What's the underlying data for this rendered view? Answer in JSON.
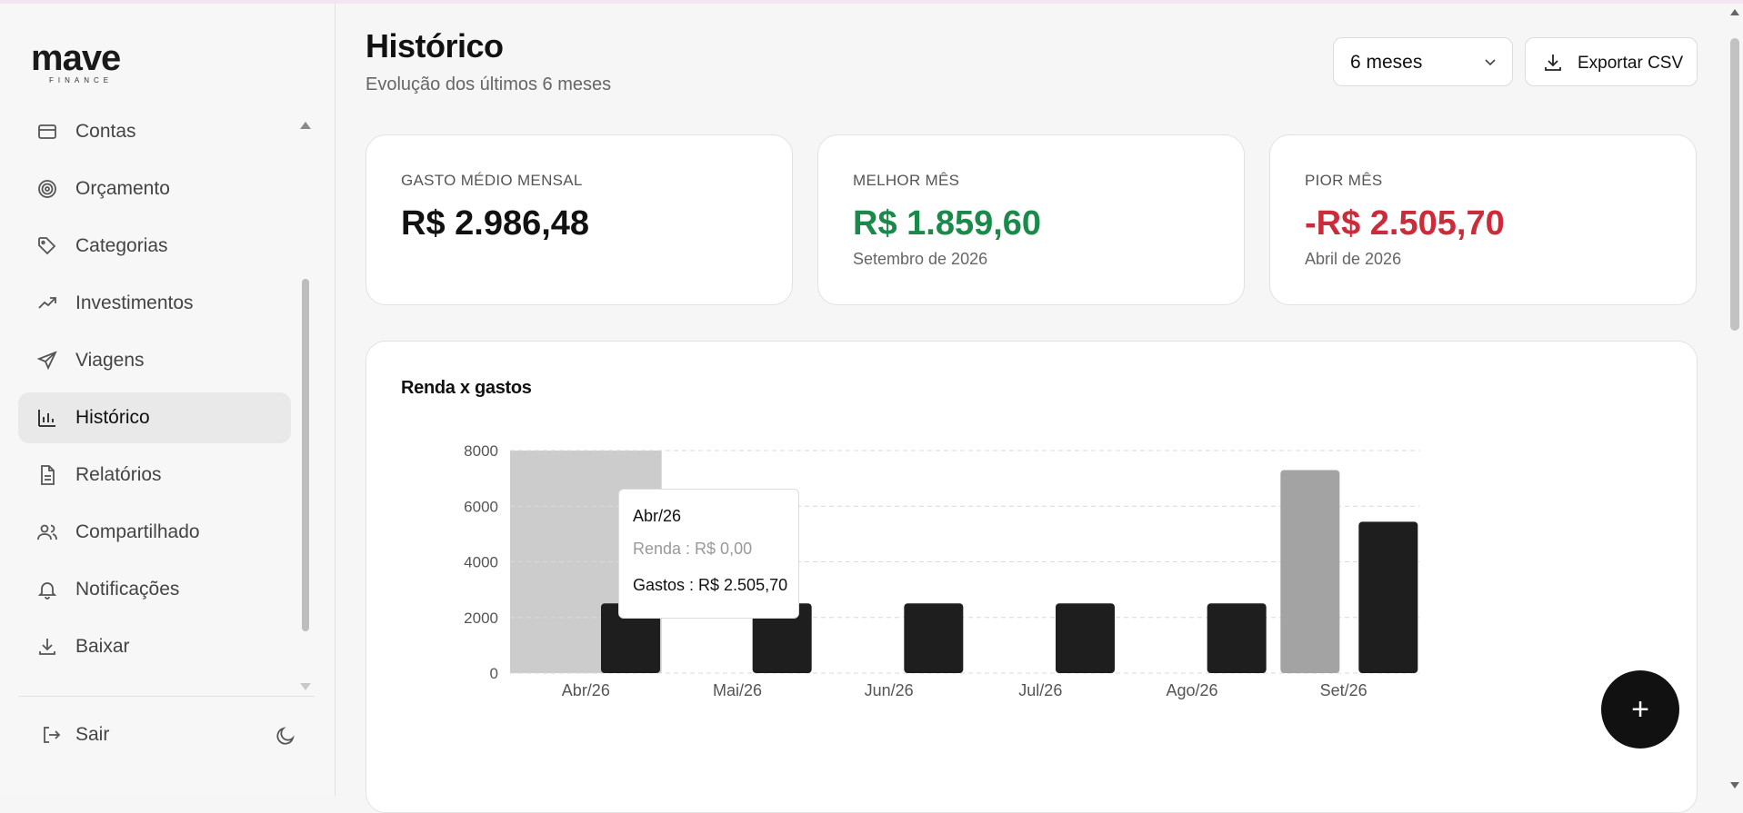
{
  "app": {
    "logo_text": "mave",
    "logo_sub": "FINANCE"
  },
  "sidebar": {
    "items": [
      {
        "label": "Contas",
        "icon": "credit-card-icon"
      },
      {
        "label": "Orçamento",
        "icon": "target-icon"
      },
      {
        "label": "Categorias",
        "icon": "tag-icon"
      },
      {
        "label": "Investimentos",
        "icon": "trending-up-icon"
      },
      {
        "label": "Viagens",
        "icon": "plane-icon"
      },
      {
        "label": "Histórico",
        "icon": "bar-chart-icon",
        "active": true
      },
      {
        "label": "Relatórios",
        "icon": "file-text-icon"
      },
      {
        "label": "Compartilhado",
        "icon": "users-icon"
      },
      {
        "label": "Notificações",
        "icon": "bell-icon"
      },
      {
        "label": "Baixar",
        "icon": "download-icon"
      }
    ],
    "logout_label": "Sair",
    "theme_icon": "moon-icon"
  },
  "header": {
    "title": "Histórico",
    "subtitle": "Evolução dos últimos 6 meses",
    "period_value": "6 meses",
    "export_label": "Exportar CSV"
  },
  "stats": [
    {
      "label": "GASTO MÉDIO MENSAL",
      "value": "R$ 2.986,48",
      "sub": "",
      "tone": "neutral"
    },
    {
      "label": "MELHOR MÊS",
      "value": "R$ 1.859,60",
      "sub": "Setembro de 2026",
      "tone": "positive",
      "color": "#1a8a4a"
    },
    {
      "label": "PIOR MÊS",
      "value": "-R$ 2.505,70",
      "sub": "Abril de 2026",
      "tone": "negative",
      "color": "#cc2b3a"
    }
  ],
  "chart": {
    "title": "Renda x gastos",
    "tooltip": {
      "month": "Abr/26",
      "income": "Renda : R$ 0,00",
      "expenses": "Gastos : R$ 2.505,70"
    }
  },
  "chart_data": {
    "type": "bar",
    "categories": [
      "Abr/26",
      "Mai/26",
      "Jun/26",
      "Jul/26",
      "Ago/26",
      "Set/26"
    ],
    "series": [
      {
        "name": "Renda",
        "values": [
          0,
          0,
          0,
          0,
          0,
          7300
        ],
        "color": "#a3a3a3"
      },
      {
        "name": "Gastos",
        "values": [
          2505.7,
          2505.7,
          2505.7,
          2505.7,
          2505.7,
          5440.4
        ],
        "color": "#1e1e1e"
      }
    ],
    "ylim": [
      0,
      8000
    ],
    "yticks": [
      0,
      2000,
      4000,
      6000,
      8000
    ],
    "grid": true,
    "highlighted_category": "Abr/26"
  },
  "fab_label": "+"
}
